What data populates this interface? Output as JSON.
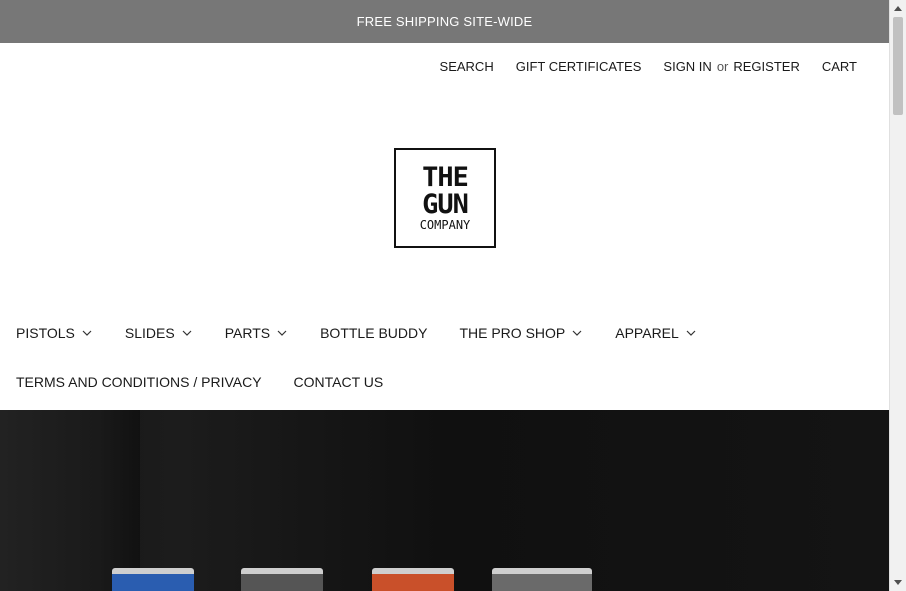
{
  "banner": {
    "text": "FREE SHIPPING SITE-WIDE"
  },
  "utility": {
    "search": "SEARCH",
    "gift": "GIFT CERTIFICATES",
    "sign_in": "SIGN IN",
    "or": "or",
    "register": "REGISTER",
    "cart": "CART"
  },
  "logo": {
    "line1": "THE",
    "line2": "GUN",
    "line3": "COMPANY"
  },
  "nav": {
    "row1": [
      {
        "label": "PISTOLS",
        "dropdown": true
      },
      {
        "label": "SLIDES",
        "dropdown": true
      },
      {
        "label": "PARTS",
        "dropdown": true
      },
      {
        "label": "BOTTLE BUDDY",
        "dropdown": false
      },
      {
        "label": "THE PRO SHOP",
        "dropdown": true
      },
      {
        "label": "APPAREL",
        "dropdown": true
      }
    ],
    "row2": [
      {
        "label": "TERMS AND CONDITIONS / PRIVACY",
        "dropdown": false
      },
      {
        "label": "CONTACT US",
        "dropdown": false
      }
    ]
  },
  "hero": {
    "pistol_colors": [
      "#2a5db0",
      "#555555",
      "#c9502a",
      "#6a6a6a"
    ]
  }
}
